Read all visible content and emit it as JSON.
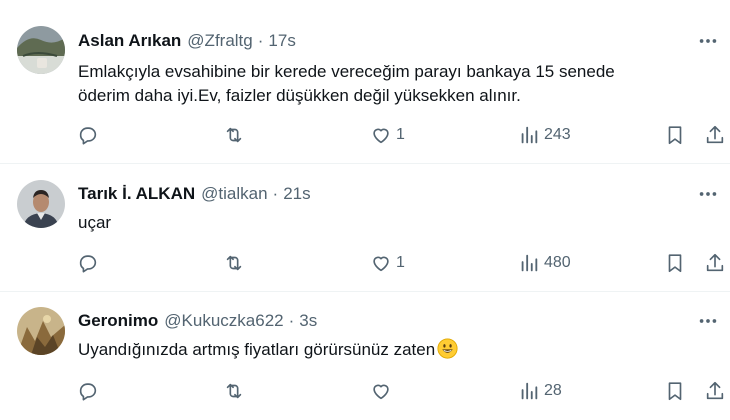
{
  "tweets": [
    {
      "name": "Aslan Arıkan",
      "handle": "@Zfraltg",
      "dot": "·",
      "time": "17s",
      "text_lines": [
        "Emlakçıyla evsahibine bir kerede vereceğim parayı bankaya 15 senede",
        "öderim daha iyi.Ev, faizler düşükken değil yüksekken alınır."
      ],
      "likes": "1",
      "views": "243"
    },
    {
      "name": "Tarık İ. ALKAN",
      "handle": "@tialkan",
      "dot": "·",
      "time": "21s",
      "text_lines": [
        "uçar"
      ],
      "likes": "1",
      "views": "480"
    },
    {
      "name": "Geronimo",
      "handle": "@Kukuczka622",
      "dot": "·",
      "time": "3s",
      "text_lines": [
        "Uyandığınızda artmış fiyatları görürsünüz zaten"
      ],
      "likes": "",
      "views": "28"
    }
  ],
  "icons": {
    "more": "more-icon",
    "reply": "reply-icon",
    "retweet": "retweet-icon",
    "like": "heart-icon",
    "views": "views-icon",
    "bookmark": "bookmark-icon",
    "share": "share-icon"
  },
  "colors": {
    "text": "#0f1419",
    "secondary": "#536471",
    "divider": "#eff3f4"
  }
}
